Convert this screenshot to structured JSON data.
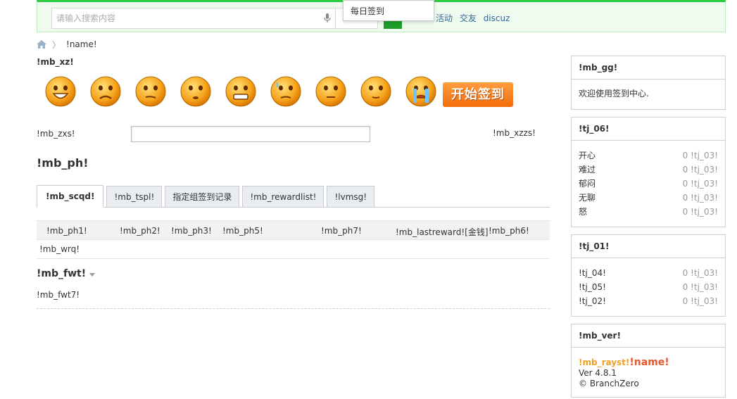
{
  "header": {
    "search_placeholder": "请输入搜索内容",
    "links": [
      "活动",
      "交友",
      "discuz"
    ],
    "dropdown_item": "每日签到"
  },
  "breadcrumb": {
    "current": "!name!"
  },
  "mood": {
    "title": "!mb_xz!",
    "faces": [
      "kaixin-face-icon",
      "nanguo-face-icon",
      "yumen-face-icon",
      "wuliao-face-icon",
      "nu-face-icon",
      "ca-han-face-icon",
      "fen-face-icon",
      "shui-face-icon",
      "ku-face-icon"
    ],
    "sign_button": "开始签到"
  },
  "say": {
    "label": "!mb_zxs!",
    "hint": "!mb_xzzs!"
  },
  "rank": {
    "title": "!mb_ph!",
    "tabs": [
      "!mb_scqd!",
      "!mb_tspl!",
      "指定组签到记录",
      "!mb_rewardlist!",
      "!lvmsg!"
    ],
    "columns": [
      "!mb_ph1!",
      "!mb_ph2!",
      "!mb_ph3!",
      "!mb_ph5!",
      "!mb_ph7!",
      "!mb_lastreward![金钱]",
      "!mb_ph6!"
    ],
    "empty": "!mb_wrq!"
  },
  "fwt": {
    "title": "!mb_fwt!",
    "text": "!mb_fwt7!"
  },
  "sidebar": {
    "notice": {
      "title": "!mb_gg!",
      "text": "欢迎使用签到中心."
    },
    "mood_stats": {
      "title": "!tj_06!",
      "rows": [
        {
          "label": "开心",
          "value": "0 !tj_03!"
        },
        {
          "label": "难过",
          "value": "0 !tj_03!"
        },
        {
          "label": "郁闷",
          "value": "0 !tj_03!"
        },
        {
          "label": "无聊",
          "value": "0 !tj_03!"
        },
        {
          "label": "怒",
          "value": "0 !tj_03!"
        }
      ]
    },
    "sign_stats": {
      "title": "!tj_01!",
      "rows": [
        {
          "label": "!tj_04!",
          "value": "0 !tj_03!"
        },
        {
          "label": "!tj_05!",
          "value": "0 !tj_03!"
        },
        {
          "label": "!tj_02!",
          "value": "0 !tj_03!"
        }
      ]
    },
    "version": {
      "title": "!mb_ver!",
      "name1": "!mb_rayst!",
      "name2": "!name!",
      "ver": "Ver 4.8.1",
      "copy": "© BranchZero"
    }
  },
  "colors": {
    "accent_green": "#2ecc40",
    "sign_orange": "#f36c0c",
    "link_blue": "#336699"
  }
}
